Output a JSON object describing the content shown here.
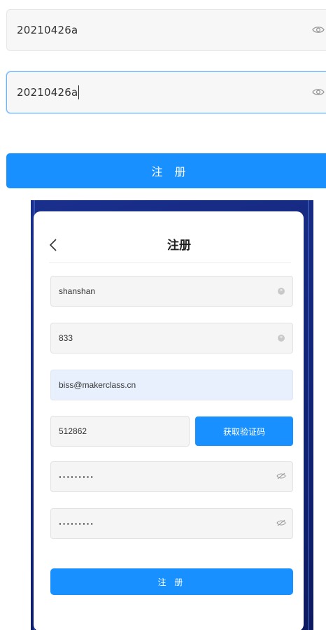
{
  "top_form": {
    "password": "20210426a",
    "confirm_password": "20210426a",
    "register_label": "注 册"
  },
  "card": {
    "back_icon": "chevron-left-icon",
    "title": "注册",
    "username": "shanshan",
    "code_field": "833",
    "email": "biss@makerclass.cn",
    "verification_code": "512862",
    "get_code_label": "获取验证码",
    "password_mask": "·········",
    "confirm_mask": "·········",
    "register_label": "注 册"
  },
  "colors": {
    "primary": "#1890ff",
    "focus_border": "#69b4ff",
    "autofill_bg": "#e8f0fe",
    "backdrop": "#13267a"
  }
}
